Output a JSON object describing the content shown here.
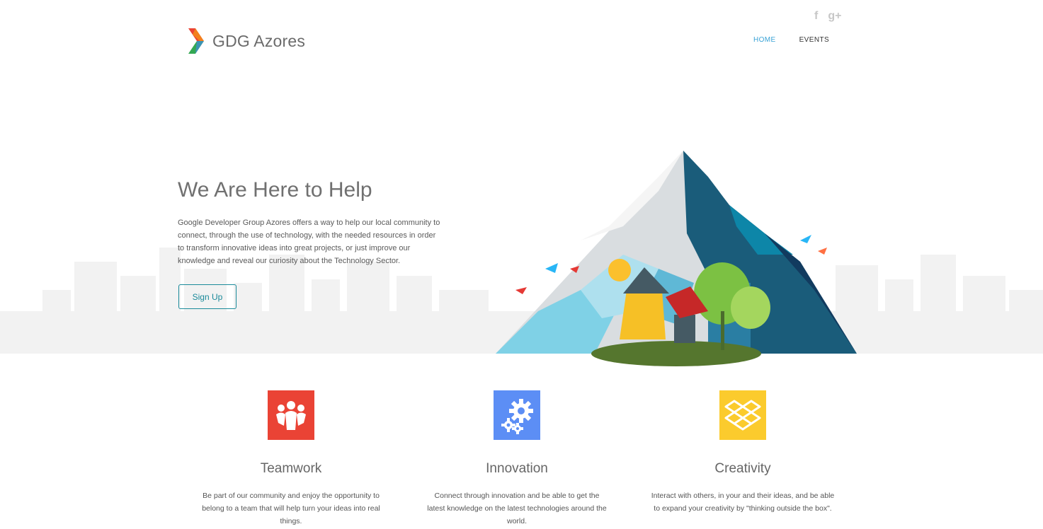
{
  "header": {
    "logo_text": "GDG Azores",
    "social": [
      {
        "icon": "facebook-icon",
        "glyph": "f"
      },
      {
        "icon": "google-plus-icon",
        "glyph": "g+"
      }
    ],
    "nav": [
      {
        "label": "HOME",
        "active": true
      },
      {
        "label": "EVENTS",
        "active": false
      }
    ]
  },
  "hero": {
    "title": "We Are Here to Help",
    "description": "Google Developer Group Azores offers a way to help our local community to connect, through the use of technology, with the needed resources in order to transform innovative ideas into great projects, or just improve our knowledge and reveal our curiosity about the Technology Sector.",
    "cta_label": "Sign Up"
  },
  "features": [
    {
      "title": "Teamwork",
      "text": "Be part of our community and enjoy the opportunity to belong to a team that will help turn your ideas into real things.",
      "color": "#ea4335",
      "icon": "team-icon"
    },
    {
      "title": "Innovation",
      "text": "Connect through innovation and be able to get the latest knowledge on the latest technologies around the world.",
      "color": "#5c8ef5",
      "icon": "gears-icon"
    },
    {
      "title": "Creativity",
      "text": "Interact with others, in your and their ideas, and be able to expand your creativity by \"thinking outside the box\".",
      "color": "#fbcb2d",
      "icon": "box-icon"
    }
  ]
}
